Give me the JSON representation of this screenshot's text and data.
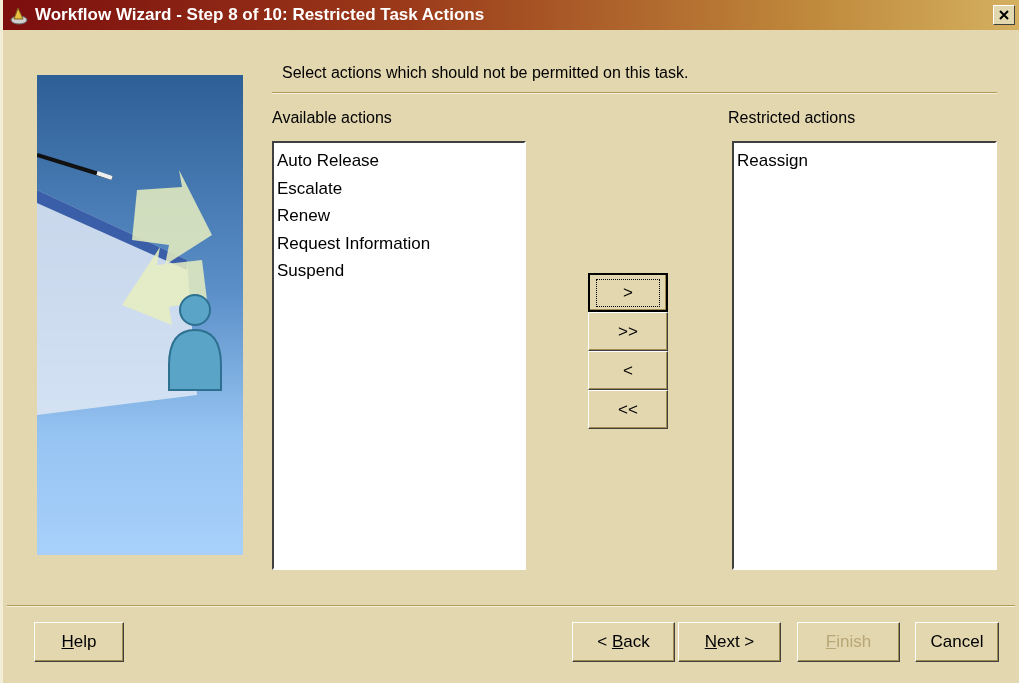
{
  "window": {
    "title": "Workflow Wizard - Step 8 of 10: Restricted Task Actions"
  },
  "instruction": "Select actions which should not be permitted on this task.",
  "available": {
    "label": "Available actions",
    "items": [
      {
        "text": "Auto Release",
        "selected": false
      },
      {
        "text": "Escalate",
        "selected": false
      },
      {
        "text": "Renew",
        "selected": false
      },
      {
        "text": "Request Information",
        "selected": false
      },
      {
        "text": "Suspend",
        "selected": false
      }
    ]
  },
  "restricted": {
    "label": "Restricted actions",
    "items": [
      {
        "text": "Reassign",
        "selected": false
      }
    ]
  },
  "transfer_buttons": [
    {
      "label": ">",
      "focused": true
    },
    {
      "label": ">>",
      "focused": false
    },
    {
      "label": "<",
      "focused": false
    },
    {
      "label": "<<",
      "focused": false
    }
  ],
  "help_button": {
    "mnemonic": "H",
    "after": "elp",
    "disabled": false
  },
  "nav_buttons": [
    {
      "before": "< ",
      "mnemonic": "B",
      "after": "ack",
      "disabled": false
    },
    {
      "mnemonic": "N",
      "after": "ext >",
      "disabled": false
    },
    {
      "mnemonic": "F",
      "after": "inish",
      "disabled": true
    },
    {
      "before": "Cancel",
      "disabled": false
    }
  ]
}
